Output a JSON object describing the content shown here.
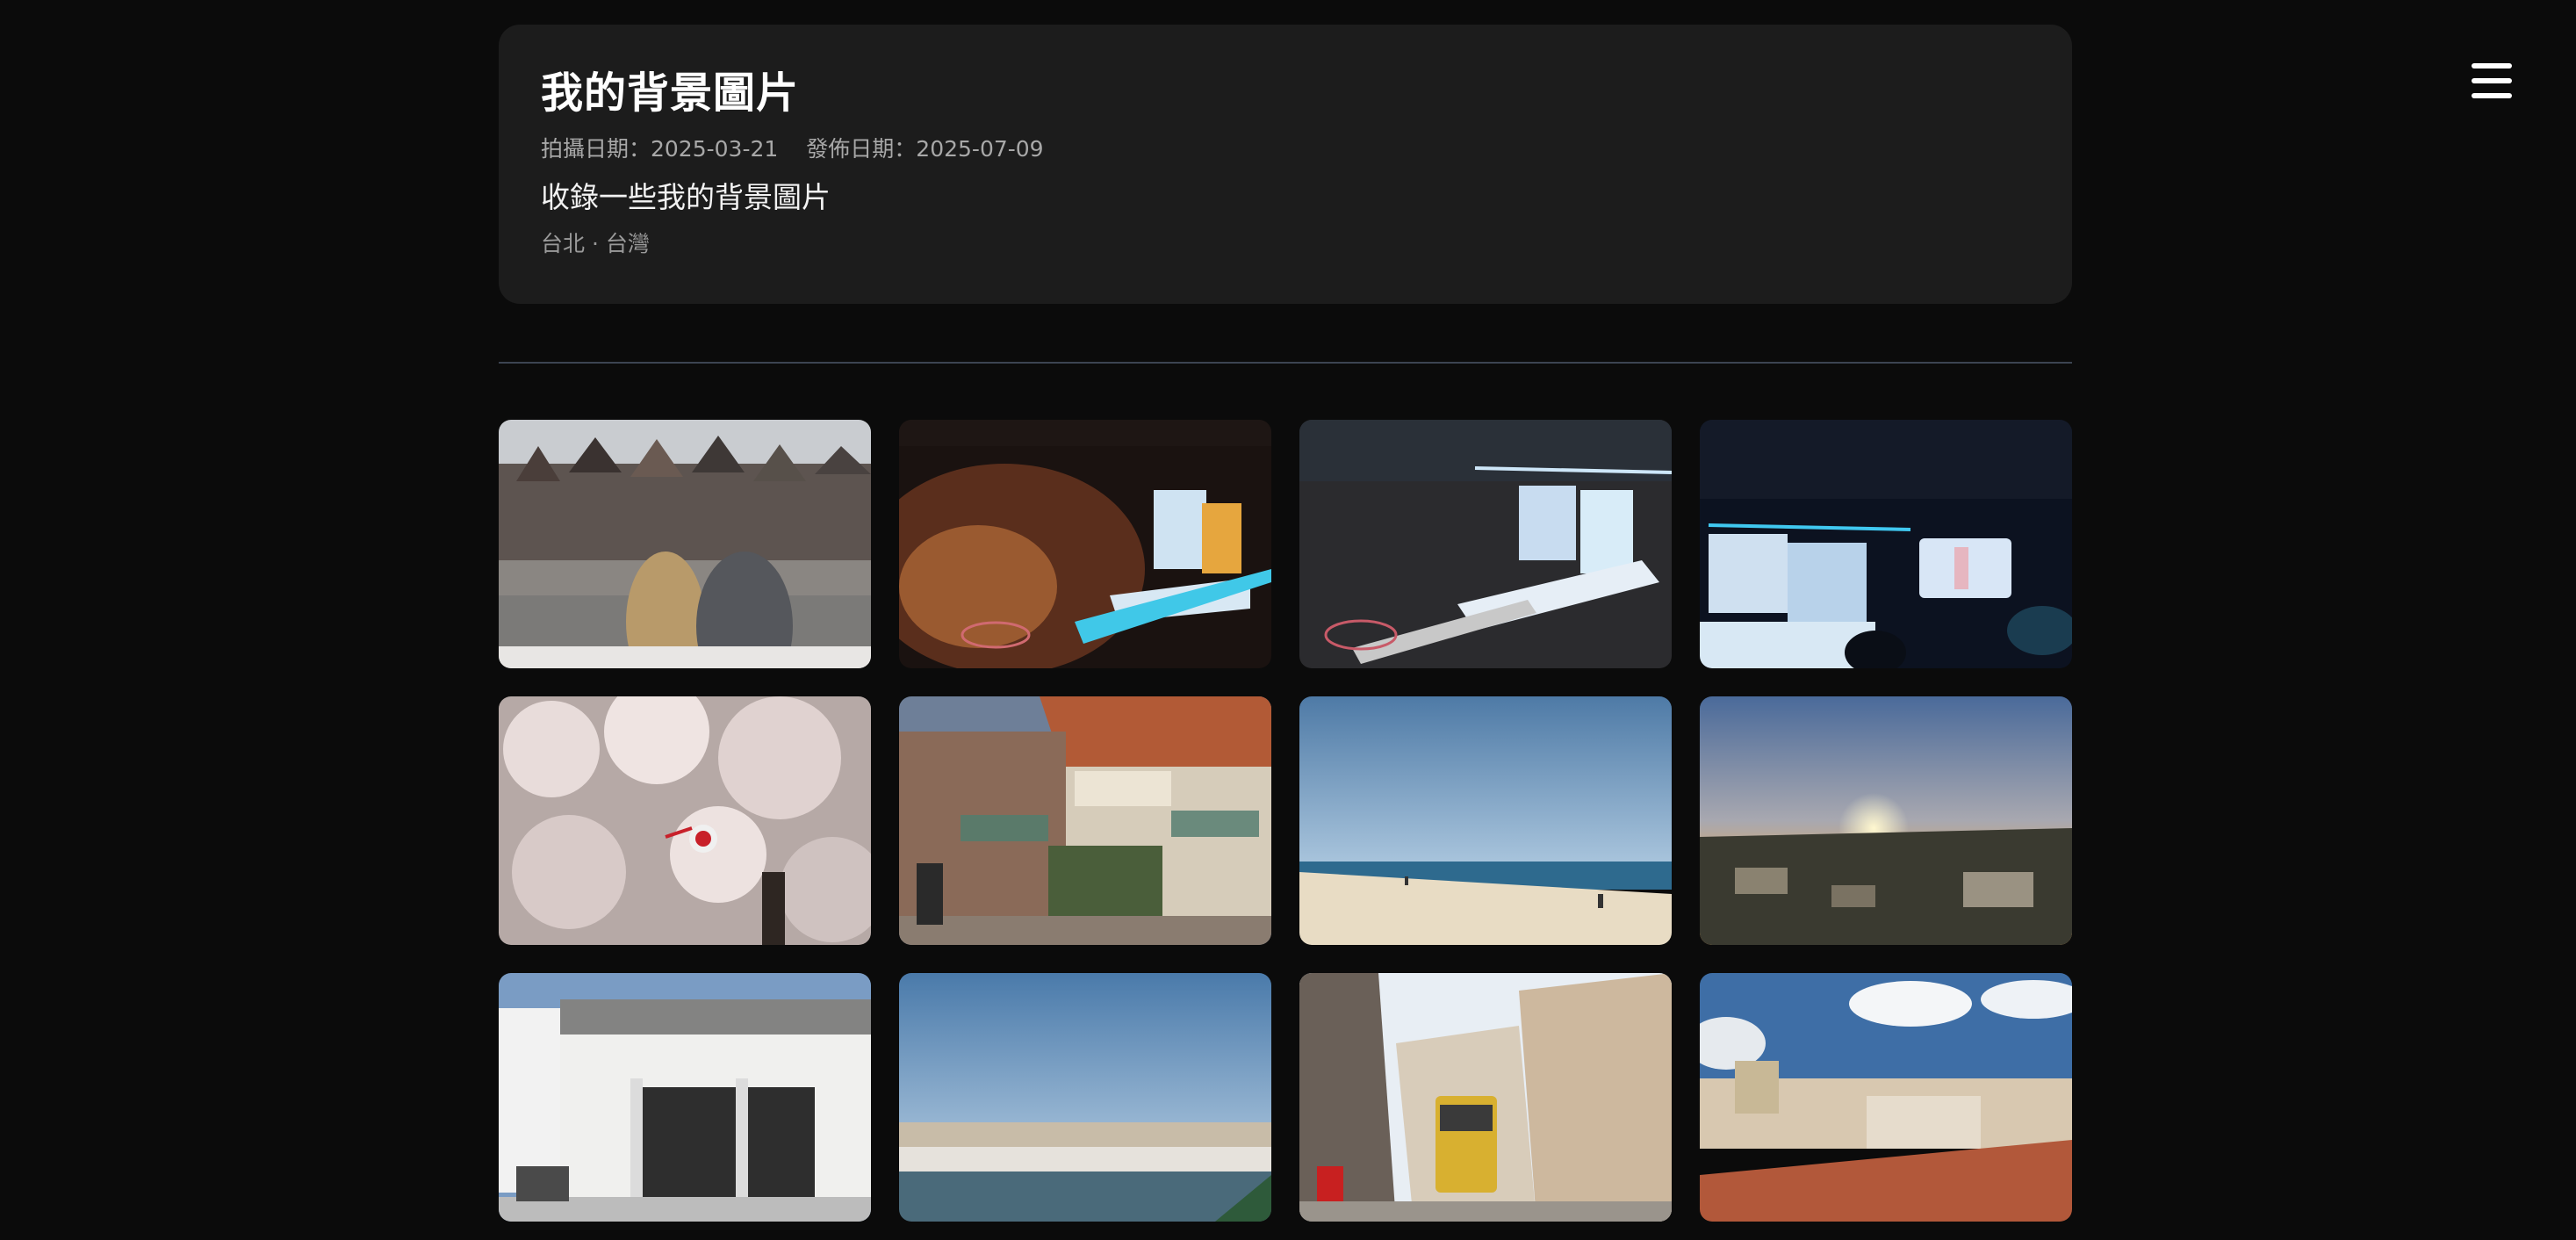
{
  "header": {
    "title": "我的背景圖片",
    "shot_date": "拍攝日期：2025-03-21",
    "publish_date": "發佈日期：2025-07-09",
    "description": "收錄一些我的背景圖片",
    "location": "台北 · 台灣"
  },
  "nav": {
    "menu_icon": "hamburger-menu-icon"
  },
  "gallery": {
    "photos": [
      {
        "subject": "amsterdam-canal-houses"
      },
      {
        "subject": "concert-stage-confetti"
      },
      {
        "subject": "concert-stage-crowd"
      },
      {
        "subject": "concert-stage-screen"
      },
      {
        "subject": "cherry-blossoms"
      },
      {
        "subject": "de-emauspoort-shop"
      },
      {
        "subject": "beach-blue-sky"
      },
      {
        "subject": "sunset-over-town"
      },
      {
        "subject": "white-cafe-building"
      },
      {
        "subject": "river-bridge"
      },
      {
        "subject": "lisbon-tram-street"
      },
      {
        "subject": "lisbon-rooftops"
      }
    ]
  }
}
